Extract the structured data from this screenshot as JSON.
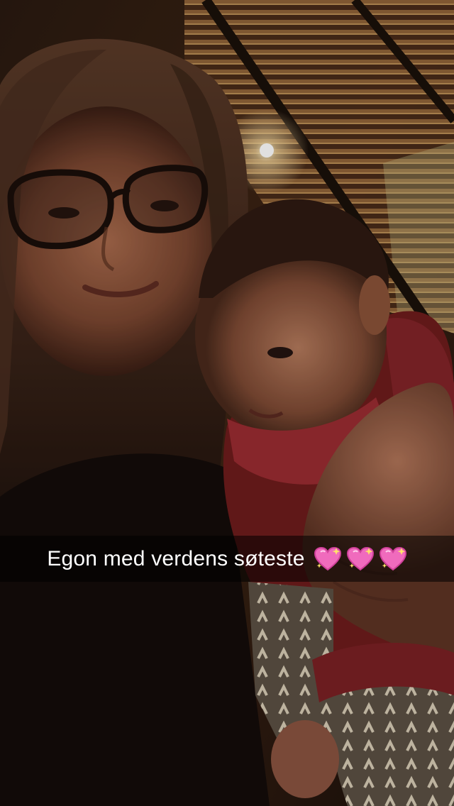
{
  "snap": {
    "caption": {
      "text": "Egon med verdens søteste",
      "emoji": [
        "sparkling-heart-icon",
        "sparkling-heart-icon",
        "sparkling-heart-icon"
      ],
      "emoji_color": "#f06bbd"
    },
    "colors": {
      "background": "#120b08",
      "caption_bar": "#000000",
      "caption_text": "#ffffff"
    }
  }
}
